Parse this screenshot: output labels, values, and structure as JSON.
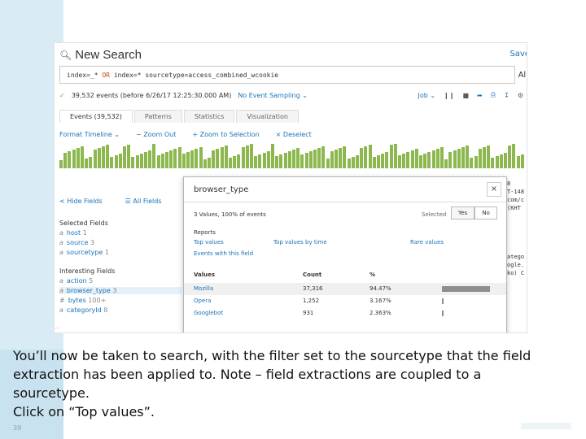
{
  "search": {
    "title": "New Search",
    "save_link": "Save",
    "query_part1": "index=_* ",
    "query_or": "OR",
    "query_part2": " index=* sourcetype=access_combined_wcookie",
    "right_text": "All",
    "events_status": "39,532 events (before 6/26/17 12:25:30.000 AM)",
    "sampling": "No Event Sampling",
    "job": "Job"
  },
  "tabs": [
    {
      "label": "Events (39,532)"
    },
    {
      "label": "Patterns"
    },
    {
      "label": "Statistics"
    },
    {
      "label": "Visualization"
    }
  ],
  "timeline": {
    "format": "Format Timeline",
    "zoom_out": "− Zoom Out",
    "zoom_sel": "+ Zoom to Selection",
    "deselect": "× Deselect"
  },
  "sidebar": {
    "hide_fields": "< Hide Fields",
    "all_fields": "☰ All Fields",
    "selected_title": "Selected Fields",
    "selected": [
      {
        "type": "a",
        "name": "host",
        "count": "1"
      },
      {
        "type": "a",
        "name": "source",
        "count": "3"
      },
      {
        "type": "a",
        "name": "sourcetype",
        "count": "1"
      }
    ],
    "interesting_title": "Interesting Fields",
    "interesting": [
      {
        "type": "a",
        "name": "action",
        "count": "5"
      },
      {
        "type": "a",
        "name": "browser_type",
        "count": "3"
      },
      {
        "type": "#",
        "name": "bytes",
        "count": "100+"
      },
      {
        "type": "a",
        "name": "categoryId",
        "count": "8"
      }
    ]
  },
  "right_snippets": [
    "8",
    "T-148",
    "com/c",
    "(KHT",
    "",
    "",
    "",
    "",
    "",
    "atego",
    "ogle.",
    "ko) C"
  ],
  "popup": {
    "title": "browser_type",
    "close": "×",
    "summary": "3 Values, 100% of events",
    "selected_label": "Selected",
    "yes": "Yes",
    "no": "No",
    "reports_label": "Reports",
    "top_values": "Top values",
    "top_values_by_time": "Top values by time",
    "rare_values": "Rare values",
    "events_with_field": "Events with this field",
    "col_values": "Values",
    "col_count": "Count",
    "col_pct": "%",
    "rows": [
      {
        "value": "Mozilla",
        "count": "37,316",
        "pct": "94.47%",
        "fraction": 0.9447
      },
      {
        "value": "Opera",
        "count": "1,252",
        "pct": "3.167%",
        "fraction": 0.03167
      },
      {
        "value": "Googlebot",
        "count": "931",
        "pct": "2.363%",
        "fraction": 0.02363
      }
    ]
  },
  "caption": {
    "line1": "You’ll now be taken to search, with the filter set to the sourcetype that the field",
    "line2": "extraction has been applied to. Note – field extractions are coupled to a",
    "line3": "sourcetype.",
    "line4": "Click on “Top values”."
  },
  "slide_number": "39",
  "colors": {
    "link": "#1a73b8",
    "histogram": "#8cb84f",
    "accent_bg": "#d9ecf5"
  }
}
